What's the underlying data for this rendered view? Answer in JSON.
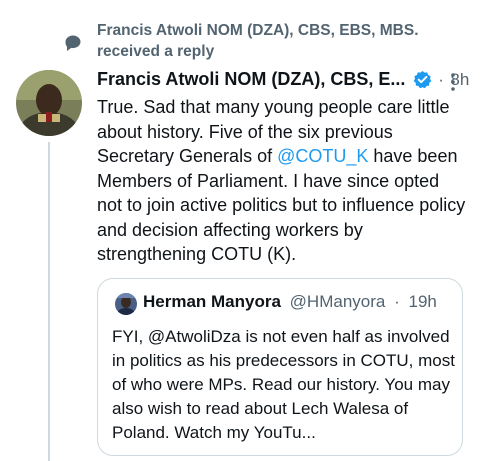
{
  "context": {
    "text": "Francis Atwoli NOM (DZA), CBS, EBS, MBS. received a reply",
    "icon": "reply-bubble-icon"
  },
  "tweet": {
    "author": "Francis Atwoli NOM (DZA), CBS, E...",
    "verified": true,
    "separator": "·",
    "time": "8h",
    "text_1": "True. Sad that many young people care little about history. Five of the six previous Secretary Generals of ",
    "mention": "@COTU_K",
    "text_2": " have been Members of Parliament. I have since opted not to join active politics but to influence policy and decision affecting workers by strengthening COTU (K)."
  },
  "quote": {
    "name": "Herman Manyora",
    "handle": "@HManyora",
    "separator": "·",
    "time": "19h",
    "text": "FYI, @AtwoliDza is not even half as involved in politics as his predecessors in COTU, most of who were MPs. Read our history. You may also wish to read about Lech Walesa of Poland. Watch my YouTu..."
  },
  "colors": {
    "accent": "#1d9bf0",
    "muted": "#536471",
    "text": "#0f1419",
    "border": "#cfd9de"
  }
}
